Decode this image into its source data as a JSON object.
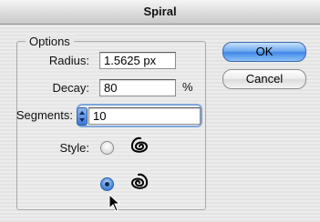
{
  "window": {
    "title": "Spiral"
  },
  "options": {
    "group_title": "Options",
    "radius": {
      "label": "Radius:",
      "value": "1.5625 px"
    },
    "decay": {
      "label": "Decay:",
      "value": "80",
      "unit": "%"
    },
    "segments": {
      "label": "Segments:",
      "value": "10"
    },
    "style": {
      "label": "Style:",
      "options": [
        {
          "icon": "spiral-counterclockwise-icon",
          "selected": false
        },
        {
          "icon": "spiral-clockwise-icon",
          "selected": true
        }
      ]
    }
  },
  "buttons": {
    "ok_label": "OK",
    "cancel_label": "Cancel"
  },
  "colors": {
    "accent": "#3f86e6",
    "focus_ring": "#7fa6d9"
  }
}
